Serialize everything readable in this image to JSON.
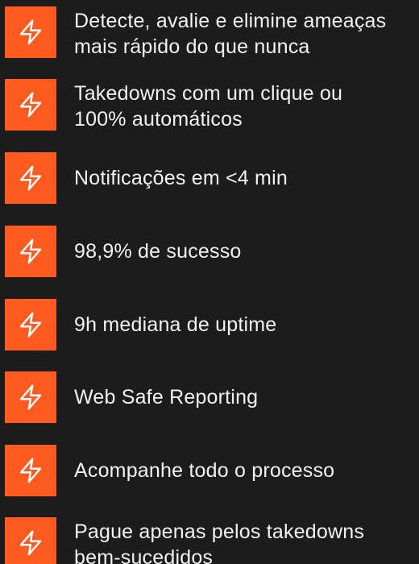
{
  "colors": {
    "background": "#1c1c1c",
    "accent": "#ff5a1f",
    "text": "#f2f2f2"
  },
  "features": [
    {
      "icon": "lightning-bolt-icon",
      "text": "Detecte, avalie e elimine ameaças\nmais rápido do que nunca"
    },
    {
      "icon": "lightning-bolt-icon",
      "text": "Takedowns com um clique ou\n100% automáticos"
    },
    {
      "icon": "lightning-bolt-icon",
      "text": "Notificações em <4 min"
    },
    {
      "icon": "lightning-bolt-icon",
      "text": "98,9% de sucesso"
    },
    {
      "icon": "lightning-bolt-icon",
      "text": "9h mediana de uptime"
    },
    {
      "icon": "lightning-bolt-icon",
      "text": "Web Safe Reporting"
    },
    {
      "icon": "lightning-bolt-icon",
      "text": "Acompanhe todo o processo"
    },
    {
      "icon": "lightning-bolt-icon",
      "text": "Pague apenas pelos takedowns\nbem-sucedidos"
    }
  ]
}
